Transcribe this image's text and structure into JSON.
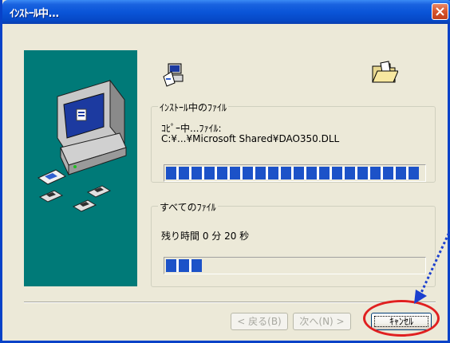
{
  "window": {
    "title": "ｲﾝｽﾄｰﾙ中...",
    "titlebar_color": "#0a55d8",
    "panel_color": "#007a78"
  },
  "current_file": {
    "group_label": "ｲﾝｽﾄｰﾙ中のﾌｧｲﾙ",
    "status_line": "ｺﾋﾟｰ中...ﾌｧｲﾙ:",
    "path": "C:¥...¥Microsoft Shared¥DAO350.DLL",
    "progress": 1.0
  },
  "all_files": {
    "group_label": "すべてのﾌｧｲﾙ",
    "time_remaining": "残り時間 0 分 20 秒",
    "progress": 0.16
  },
  "buttons": {
    "back": "< 戻る(B)",
    "next": "次へ(N) >",
    "cancel": "ｷｬﾝｾﾙ"
  },
  "annotation": {
    "highlight_color": "#e02020",
    "arrow_color": "#1a3fcf"
  }
}
